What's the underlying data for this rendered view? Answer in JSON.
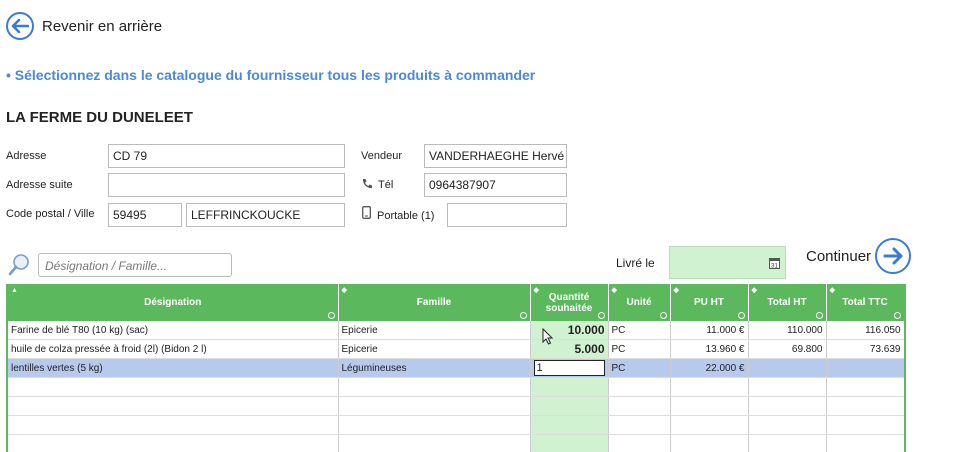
{
  "nav": {
    "back_label": "Revenir en arrière"
  },
  "instruction": "• Sélectionnez dans le catalogue du fournisseur tous les produits à commander",
  "supplier": {
    "name": "LA FERME DU DUNELEET",
    "address_label": "Adresse",
    "address": "CD 79",
    "address2_label": "Adresse suite",
    "address2": "",
    "postal_city_label": "Code postal / Ville",
    "postal_code": "59495",
    "city": "LEFFRINCKOUCKE",
    "seller_label": "Vendeur",
    "seller": "VANDERHAEGHE Hervé",
    "phone_label": "Tél",
    "phone": "0964387907",
    "mobile_label": "Portable (1)",
    "mobile": ""
  },
  "search": {
    "placeholder": "Désignation / Famille..."
  },
  "delivery": {
    "label": "Livré le",
    "value": ""
  },
  "continue_label": "Continuer",
  "table": {
    "headers": {
      "designation": "Désignation",
      "famille": "Famille",
      "quantite_line1": "Quantité",
      "quantite_line2": "souhaitée",
      "unite": "Unité",
      "pu_ht": "PU HT",
      "total_ht": "Total HT",
      "total_ttc": "Total TTC"
    },
    "rows": [
      {
        "designation": "Farine de blé T80 (10 kg) (sac)",
        "famille": "Epicerie",
        "quantite": "10.000",
        "unite": "PC",
        "pu_ht": "11.000 €",
        "total_ht": "110.000",
        "total_ttc": "116.050"
      },
      {
        "designation": "huile de colza pressée à froid (2l) (Bidon 2 l)",
        "famille": "Epicerie",
        "quantite": "5.000",
        "unite": "PC",
        "pu_ht": "13.960 €",
        "total_ht": "69.800",
        "total_ttc": "73.639"
      },
      {
        "designation": "lentilles vertes (5 kg)",
        "famille": "Légumineuses",
        "quantite": "1",
        "unite": "PC",
        "pu_ht": "22.000 €",
        "total_ht": "",
        "total_ttc": ""
      }
    ]
  },
  "colors": {
    "accent": "#3a7bd5",
    "header_green": "#5cb85c",
    "qty_green": "#d0f2d0",
    "selected_row": "#b7caee",
    "instruction_blue": "#4a8ad8"
  },
  "icons": {
    "back": "arrow-left-circle-icon",
    "continue": "arrow-right-circle-icon",
    "search": "magnifier-icon",
    "phone": "phone-icon",
    "mobile": "mobile-icon",
    "calendar": "calendar-icon"
  }
}
